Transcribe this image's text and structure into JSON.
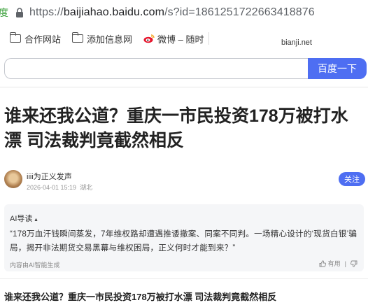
{
  "address_bar": {
    "prefix": "度",
    "url_scheme": "https://",
    "url_host": "baijiahao.baidu.com",
    "url_path": "/s?id=1861251722663418876"
  },
  "bookmarks": [
    {
      "label": "合作网站",
      "icon": "folder-icon"
    },
    {
      "label": "添加信息网",
      "icon": "folder-icon"
    },
    {
      "label": "微博 – 随时",
      "icon": "weibo-icon"
    }
  ],
  "watermark": "bianji.net",
  "search": {
    "value": "",
    "button_label": "百度一下"
  },
  "article": {
    "title": "谁来还我公道？重庆一市民投资178万被打水漂 司法裁判竟截然相反",
    "author": "iiii为正义发声",
    "date": "2026-04-01 15:19",
    "location": "湖北",
    "follow_label": "关注"
  },
  "ai_summary": {
    "title": "AI导读",
    "text": "“178万血汗钱瞬间蒸发，7年维权路却遭遇推诿撤案、同案不同判。一场精心设计的‘现货白银’骗局，揭开非法期货交易黑幕与维权困局，正义何时才能到来？”",
    "footer": "内容由AI智能生成",
    "useful_label": "有用"
  },
  "subtitle": "谁来还我公道？重庆一市民投资178万被打水漂 司法裁判竟截然相反",
  "colors": {
    "accent": "#4e6ef2",
    "secure": "#3aa03a"
  }
}
